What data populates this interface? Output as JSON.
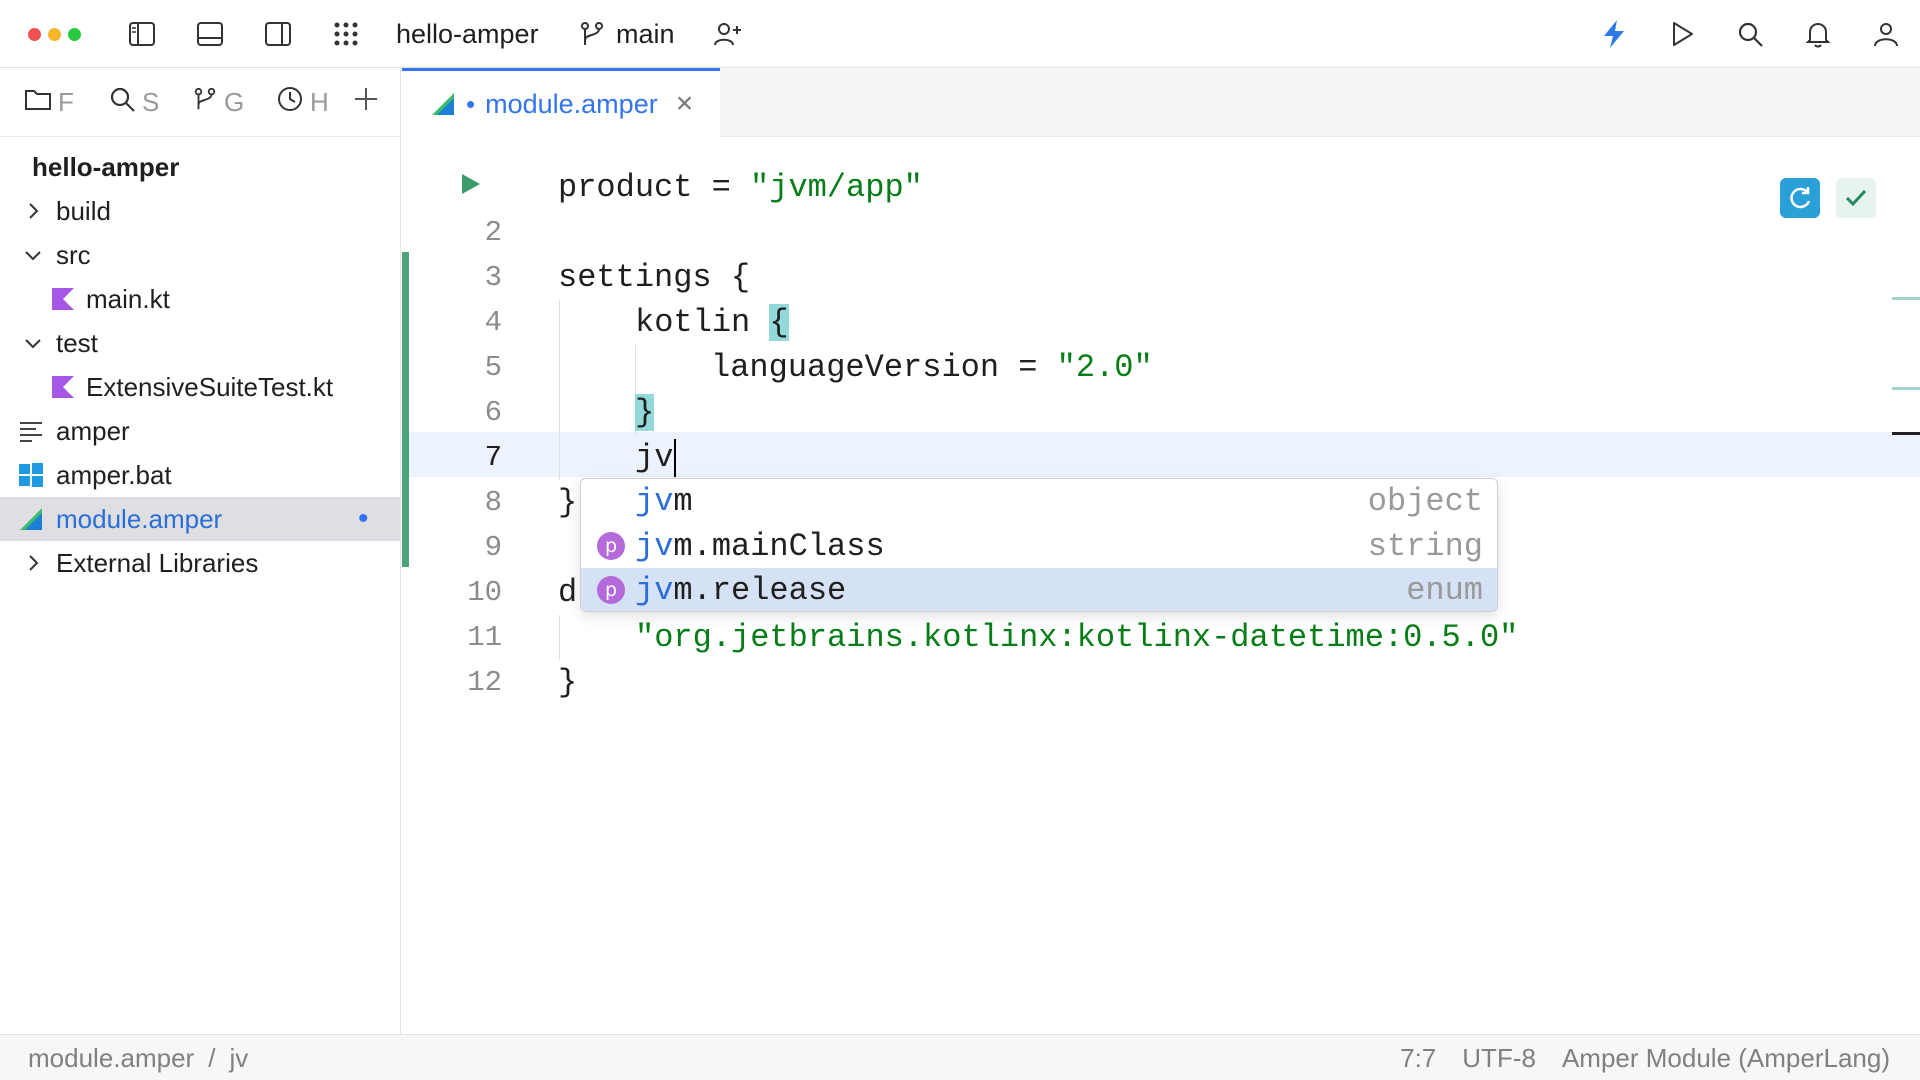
{
  "titlebar": {
    "project": "hello-amper",
    "branch": "main",
    "traffic_colors": [
      "#f0524f",
      "#f7b52b",
      "#28c840"
    ],
    "icons": [
      "sidebar-left-icon",
      "panel-bottom-icon",
      "sidebar-right-icon",
      "apps-grid-icon",
      "branch-icon",
      "add-user-icon",
      "lightning-icon",
      "run-icon",
      "search-icon",
      "bell-icon",
      "account-icon"
    ]
  },
  "side_tabs": [
    {
      "icon": "folder-icon",
      "label": "F"
    },
    {
      "icon": "search-icon",
      "label": "S"
    },
    {
      "icon": "branch-icon",
      "label": "G"
    },
    {
      "icon": "clock-icon",
      "label": "H"
    }
  ],
  "tree": {
    "root": "hello-amper",
    "items": [
      {
        "label": "build",
        "chevron": "›",
        "icon": "none"
      },
      {
        "label": "src",
        "chevron": "⌄",
        "icon": "none"
      },
      {
        "label": "main.kt",
        "icon": "kotlin-file-icon"
      },
      {
        "label": "test",
        "chevron": "⌄",
        "icon": "none"
      },
      {
        "label": "ExtensiveSuiteTest.kt",
        "icon": "kotlin-file-icon"
      },
      {
        "label": "amper",
        "icon": "text-file-icon"
      },
      {
        "label": "amper.bat",
        "icon": "windows-icon"
      },
      {
        "label": "module.amper",
        "icon": "amper-file-icon",
        "modified": "•"
      },
      {
        "label": "External Libraries",
        "chevron": "›",
        "icon": "none"
      }
    ]
  },
  "editor_tab": {
    "label": "module.amper",
    "modified": "•",
    "close": "×"
  },
  "code": {
    "line_numbers": [
      "2",
      "3",
      "4",
      "5",
      "6",
      "7",
      "8",
      "9",
      "10",
      "11",
      "12"
    ],
    "l1_key": "product = ",
    "l1_val": "\"jvm/app\"",
    "l3": "settings {",
    "l4": "kotlin ",
    "l4_brace": "{",
    "l5_key": "languageVersion = ",
    "l5_val": "\"2.0\"",
    "l6": "}",
    "l7": "jv",
    "l8": "}",
    "l10": "d",
    "l11": "\"org.jetbrains.kotlinx:kotlinx-datetime:0.5.0\"",
    "l12": "}"
  },
  "completion": {
    "typed": "jv",
    "items": [
      {
        "rest": "m",
        "type": "object",
        "badge": ""
      },
      {
        "rest": "m.mainClass",
        "type": "string",
        "badge": "p"
      },
      {
        "rest": "m.release",
        "type": "enum",
        "badge": "p"
      }
    ],
    "accent": "#2a6ed8",
    "badge_color": "#b46ad8"
  },
  "status": {
    "breadcrumb": [
      "module.amper",
      "/",
      "jv"
    ],
    "position": "7:7",
    "encoding": "UTF-8",
    "language": "Amper Module (AmperLang)"
  }
}
